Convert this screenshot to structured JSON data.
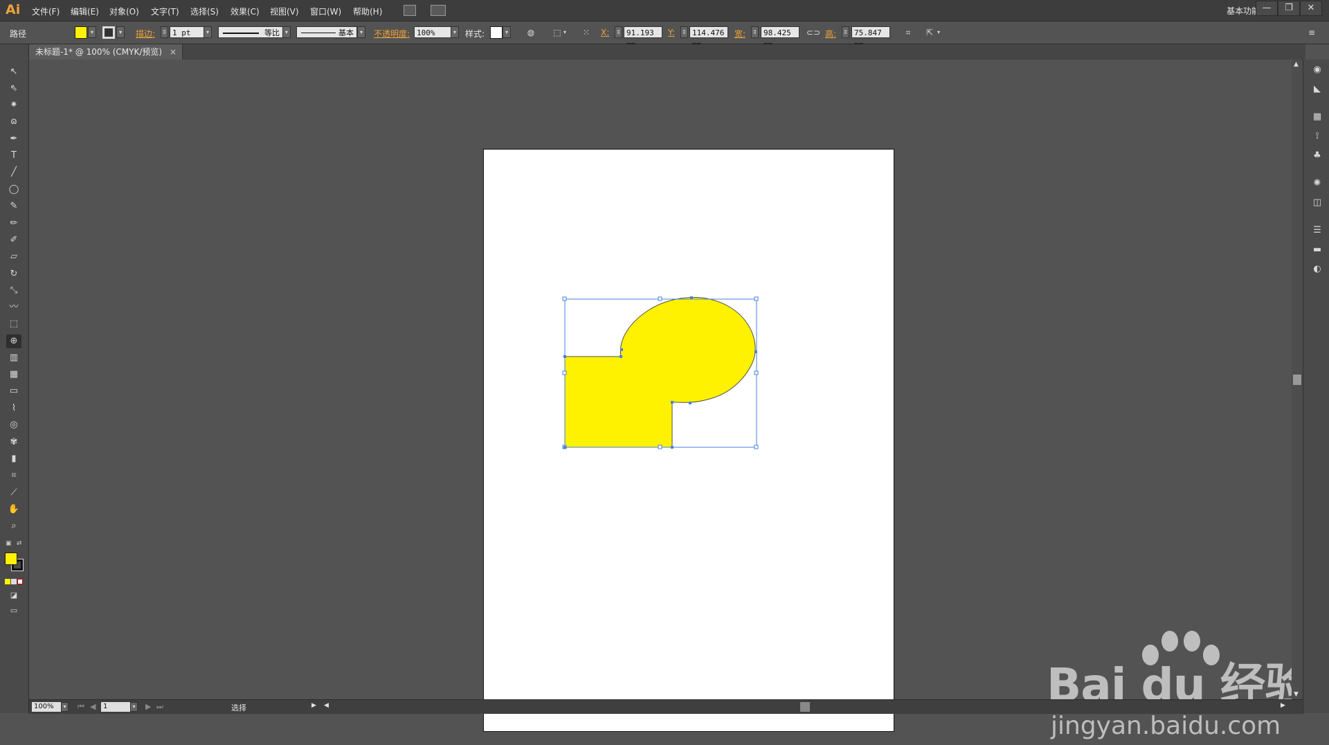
{
  "app": {
    "logo": "Ai",
    "accent": "#f0a23a"
  },
  "menu": [
    "文件(F)",
    "编辑(E)",
    "对象(O)",
    "文字(T)",
    "选择(S)",
    "效果(C)",
    "视图(V)",
    "窗口(W)",
    "帮助(H)"
  ],
  "workspace_label": "基本功能",
  "window_controls": {
    "minimize": "—",
    "restore": "❐",
    "close": "✕"
  },
  "control": {
    "selection_type": "路径",
    "fill_color": "#fff200",
    "stroke_label": "描边:",
    "stroke_weight": "1 pt",
    "profile_label": "等比",
    "brush_label": "基本",
    "opacity_label": "不透明度:",
    "opacity_value": "100%",
    "style_label": "样式:",
    "x_label": "X:",
    "x_value": "91.193 mm",
    "y_label": "Y:",
    "y_value": "114.476 mm",
    "w_label": "宽:",
    "w_value": "98.425 mm",
    "h_label": "高:",
    "h_value": "75.847 mm"
  },
  "document": {
    "tab_title": "未标题-1* @ 100% (CMYK/预览)",
    "close": "×"
  },
  "shape": {
    "fill": "#fff200",
    "stroke": "#4d4d4d",
    "selection_color": "#4a7fe0"
  },
  "status": {
    "zoom": "100%",
    "artboard_index": "1",
    "tool_name": "选择"
  },
  "watermark": {
    "big": "Bai du 经验",
    "small": "jingyan.baidu.com"
  },
  "tool_icons": [
    "selection-tool-icon",
    "direct-selection-tool-icon",
    "magic-wand-tool-icon",
    "lasso-tool-icon",
    "pen-tool-icon",
    "type-tool-icon",
    "line-tool-icon",
    "ellipse-tool-icon",
    "paintbrush-tool-icon",
    "pencil-tool-icon",
    "blob-brush-tool-icon",
    "eraser-tool-icon",
    "rotate-tool-icon",
    "scale-tool-icon",
    "warp-tool-icon",
    "free-transform-tool-icon",
    "shape-builder-tool-icon",
    "perspective-grid-tool-icon",
    "mesh-tool-icon",
    "gradient-tool-icon",
    "eyedropper-tool-icon",
    "blend-tool-icon",
    "symbol-sprayer-tool-icon",
    "column-graph-tool-icon",
    "artboard-tool-icon",
    "slice-tool-icon",
    "hand-tool-icon",
    "zoom-tool-icon"
  ]
}
